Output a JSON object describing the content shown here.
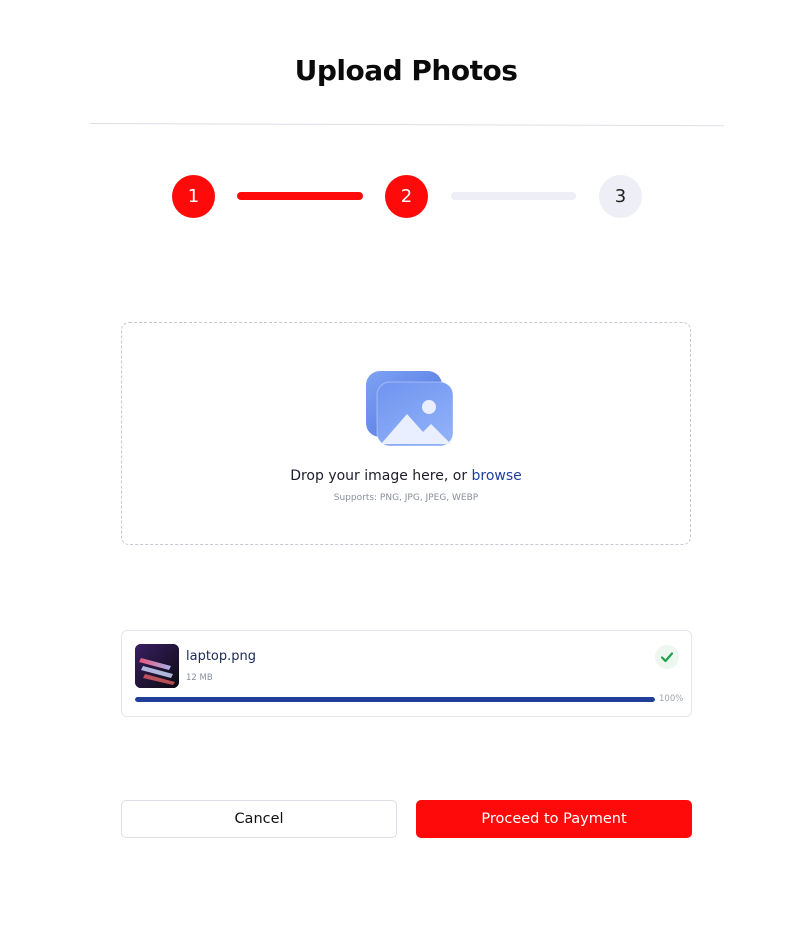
{
  "header": {
    "title": "Upload Photos"
  },
  "stepper": {
    "steps": [
      {
        "label": "1",
        "state": "complete"
      },
      {
        "label": "2",
        "state": "complete"
      },
      {
        "label": "3",
        "state": "pending"
      }
    ],
    "active_color": "#ff0a0a",
    "inactive_color": "#eeeff6"
  },
  "dropzone": {
    "icon": "image-gallery-icon",
    "prompt": "Drop your image here, or",
    "browse_label": "browse",
    "supports": "Supports: PNG, JPG, JPEG, WEBP"
  },
  "upload": {
    "file_name": "laptop.png",
    "file_size": "12 MB",
    "progress_label": "100%",
    "progress_value": 1.0,
    "status_icon": "check-icon",
    "status_color": "#1aa34a",
    "progress_color": "#1f3f99"
  },
  "actions": {
    "cancel_label": "Cancel",
    "proceed_label": "Proceed to Payment"
  }
}
